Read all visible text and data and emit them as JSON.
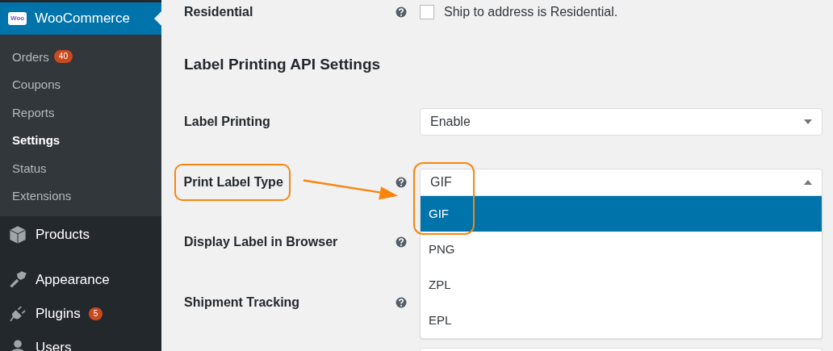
{
  "sidebar": {
    "header": {
      "logo": "Woo",
      "label": "WooCommerce",
      "selected": true
    },
    "submenu": [
      {
        "label": "Orders",
        "badge": "40",
        "selected": false
      },
      {
        "label": "Coupons",
        "selected": false
      },
      {
        "label": "Reports",
        "selected": false
      },
      {
        "label": "Settings",
        "selected": true
      },
      {
        "label": "Status",
        "selected": false
      },
      {
        "label": "Extensions",
        "selected": false
      }
    ],
    "menu": [
      {
        "label": "Products",
        "kind": "box"
      },
      {
        "label": "Appearance",
        "kind": "brush"
      },
      {
        "label": "Plugins",
        "kind": "plug",
        "badge": "5"
      },
      {
        "label": "Users",
        "kind": "user"
      }
    ]
  },
  "residential": {
    "label": "Residential",
    "help": true,
    "checkbox": {
      "checked": false,
      "label": "Ship to address is Residential."
    }
  },
  "section_heading": "Label Printing API Settings",
  "fields": [
    {
      "label": "Label Printing",
      "help": false,
      "highlighted": false,
      "control": {
        "kind": "select",
        "value": "Enable",
        "expanded": false
      }
    },
    {
      "label": "Print Label Type",
      "help": true,
      "highlighted": true,
      "control": {
        "kind": "select",
        "value": "GIF",
        "expanded": true,
        "options": [
          {
            "label": "GIF",
            "selected": true
          },
          {
            "label": "PNG",
            "selected": false
          },
          {
            "label": "ZPL",
            "selected": false
          },
          {
            "label": "EPL",
            "selected": false
          }
        ]
      }
    },
    {
      "label": "Display Label in Browser",
      "help": true,
      "highlighted": false
    },
    {
      "label": "Shipment Tracking",
      "help": true,
      "highlighted": false
    },
    {
      "help": false,
      "control": {
        "kind": "field"
      }
    }
  ]
}
